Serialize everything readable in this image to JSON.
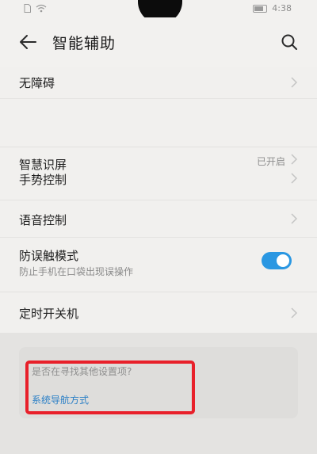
{
  "status_bar": {
    "time": "4:38"
  },
  "header": {
    "title": "智能辅助"
  },
  "list": {
    "items": [
      {
        "label": "无障碍"
      },
      {
        "label": "智慧识屏",
        "status": "已开启"
      },
      {
        "label": "手势控制"
      },
      {
        "label": "语音控制"
      },
      {
        "label": "防误触模式",
        "sublabel": "防止手机在口袋出现误操作",
        "toggle_on": true
      },
      {
        "label": "定时开关机"
      }
    ]
  },
  "suggestion": {
    "question": "是否在寻找其他设置项?",
    "link": "系统导航方式"
  },
  "colors": {
    "accent": "#2a97e2",
    "highlight": "#e8202a",
    "link": "#2a7fc6"
  },
  "icons": [
    "sim-icon",
    "wifi-icon",
    "battery-icon",
    "back-arrow-icon",
    "search-icon",
    "chevron-right-icon"
  ]
}
